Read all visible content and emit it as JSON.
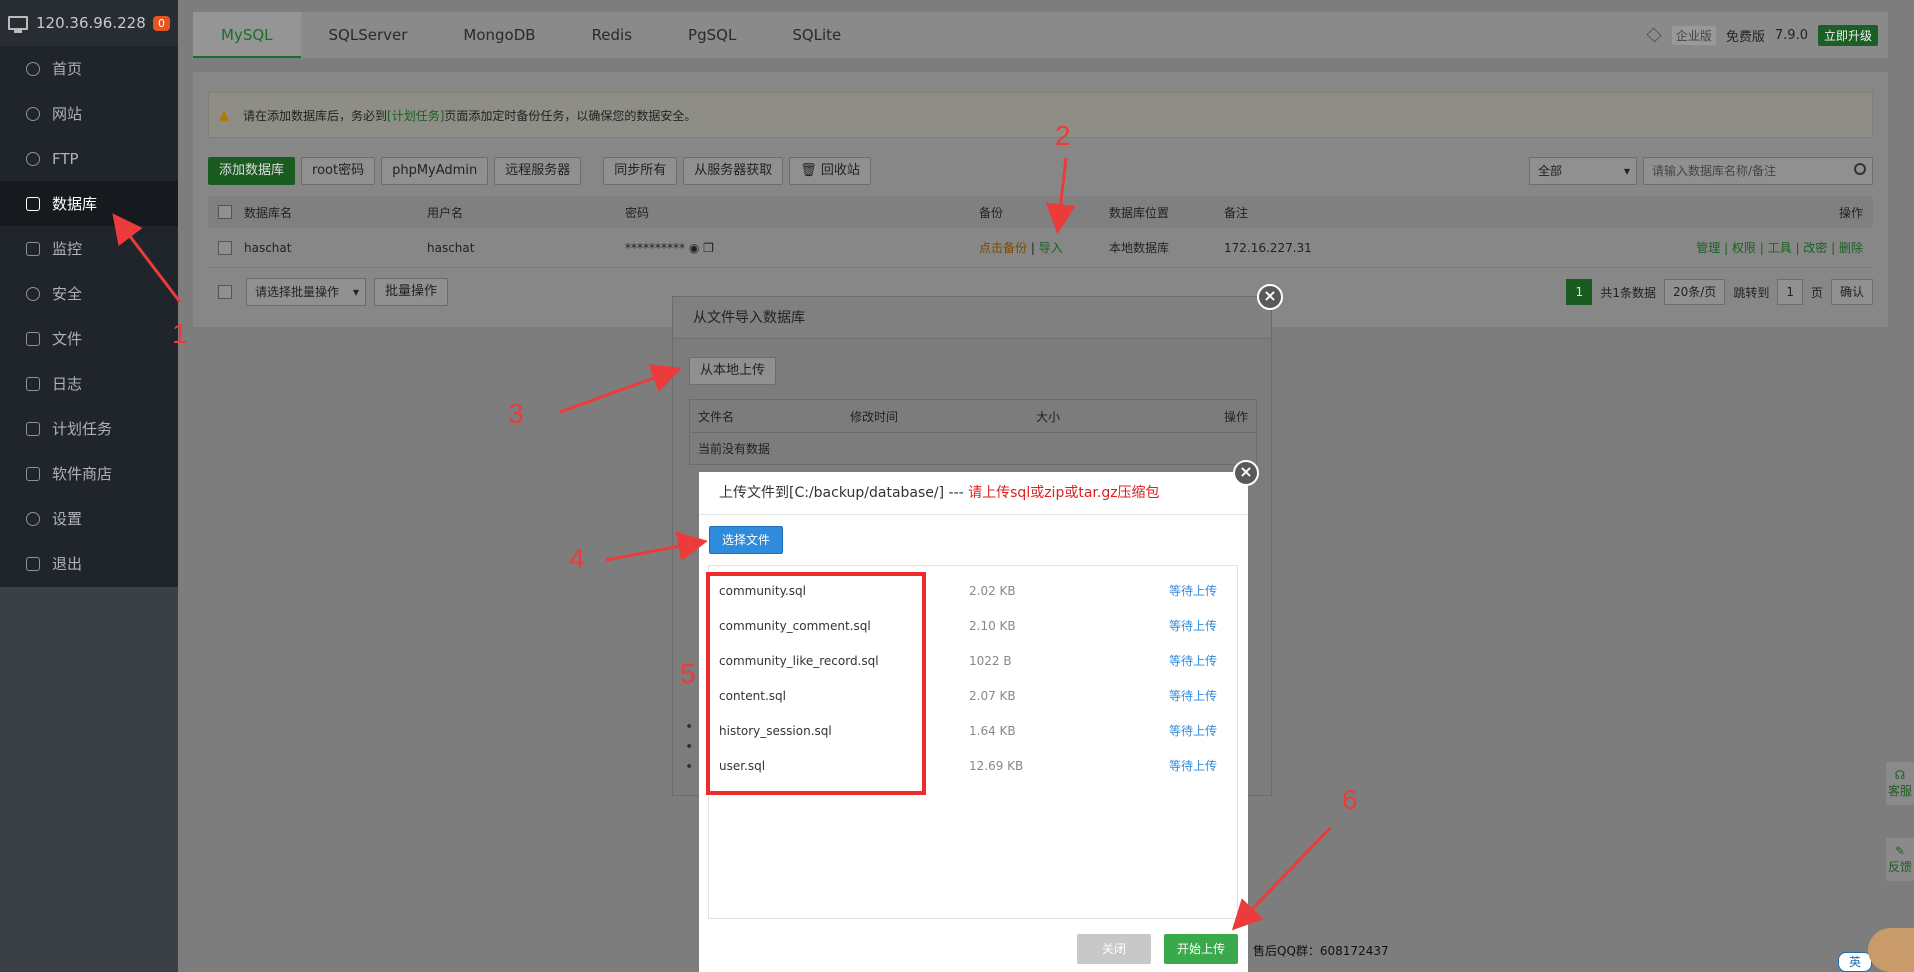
{
  "sidebar": {
    "ip": "120.36.96.228",
    "badge": "0",
    "items": [
      {
        "label": "首页",
        "icon": "home-icon"
      },
      {
        "label": "网站",
        "icon": "globe-icon"
      },
      {
        "label": "FTP",
        "icon": "ftp-icon"
      },
      {
        "label": "数据库",
        "icon": "database-icon"
      },
      {
        "label": "监控",
        "icon": "monitor-icon"
      },
      {
        "label": "安全",
        "icon": "shield-icon"
      },
      {
        "label": "文件",
        "icon": "folder-icon"
      },
      {
        "label": "日志",
        "icon": "log-icon"
      },
      {
        "label": "计划任务",
        "icon": "calendar-icon"
      },
      {
        "label": "软件商店",
        "icon": "grid-icon"
      },
      {
        "label": "设置",
        "icon": "gear-icon"
      },
      {
        "label": "退出",
        "icon": "logout-icon"
      }
    ]
  },
  "tabs": [
    "MySQL",
    "SQLServer",
    "MongoDB",
    "Redis",
    "PgSQL",
    "SQLite"
  ],
  "header_right": {
    "enterprise": "企业版",
    "free": "免费版",
    "version": "7.9.0",
    "upgrade": "立即升级"
  },
  "notice": {
    "pre": "请在添加数据库后，务必到",
    "link": "[计划任务]",
    "post": "页面添加定时备份任务，以确保您的数据安全。"
  },
  "toolbar": {
    "add": "添加数据库",
    "root": "root密码",
    "pma": "phpMyAdmin",
    "remote": "远程服务器",
    "sync_all": "同步所有",
    "from_server": "从服务器获取",
    "recycle": "回收站",
    "filter": "全部",
    "search_placeholder": "请输入数据库名称/备注"
  },
  "table": {
    "headers": {
      "name": "数据库名",
      "user": "用户名",
      "password": "密码",
      "backup": "备份",
      "location": "数据库位置",
      "remark": "备注",
      "ops": "操作"
    },
    "row": {
      "name": "haschat",
      "user": "haschat",
      "password": "**********",
      "backup": "点击备份",
      "import": "导入",
      "location": "本地数据库",
      "remark": "172.16.227.31",
      "ops": [
        "管理",
        "权限",
        "工具",
        "改密",
        "删除"
      ]
    }
  },
  "pagination": {
    "batch_placeholder": "请选择批量操作",
    "batch_btn": "批量操作",
    "page": "1",
    "total": "共1条数据",
    "per_page": "20条/页",
    "jump": "跳转到",
    "jump_value": "1",
    "page_unit": "页",
    "confirm": "确认"
  },
  "footer": {
    "qq": "售后QQ群：608172437"
  },
  "float": {
    "service": "客服",
    "feedback": "反馈"
  },
  "dialog_import": {
    "title": "从文件导入数据库",
    "upload_local": "从本地上传",
    "cols": {
      "name": "文件名",
      "mtime": "修改时间",
      "size": "大小",
      "ops": "操作"
    },
    "empty": "当前没有数据"
  },
  "dialog_upload": {
    "title": "上传文件到[C:/backup/database/] ---",
    "hint": "请上传sql或zip或tar.gz压缩包",
    "choose": "选择文件",
    "files": [
      {
        "name": "community.sql",
        "size": "2.02 KB",
        "status": "等待上传"
      },
      {
        "name": "community_comment.sql",
        "size": "2.10 KB",
        "status": "等待上传"
      },
      {
        "name": "community_like_record.sql",
        "size": "1022 B",
        "status": "等待上传"
      },
      {
        "name": "content.sql",
        "size": "2.07 KB",
        "status": "等待上传"
      },
      {
        "name": "history_session.sql",
        "size": "1.64 KB",
        "status": "等待上传"
      },
      {
        "name": "user.sql",
        "size": "12.69 KB",
        "status": "等待上传"
      }
    ],
    "close": "关闭",
    "start": "开始上传"
  },
  "annotations": [
    "1",
    "2",
    "3",
    "4",
    "5",
    "6"
  ],
  "ime": "英",
  "colors": {
    "accent": "#20a53a",
    "annotation": "#ec3b3b",
    "link": "#2f8bdc"
  }
}
